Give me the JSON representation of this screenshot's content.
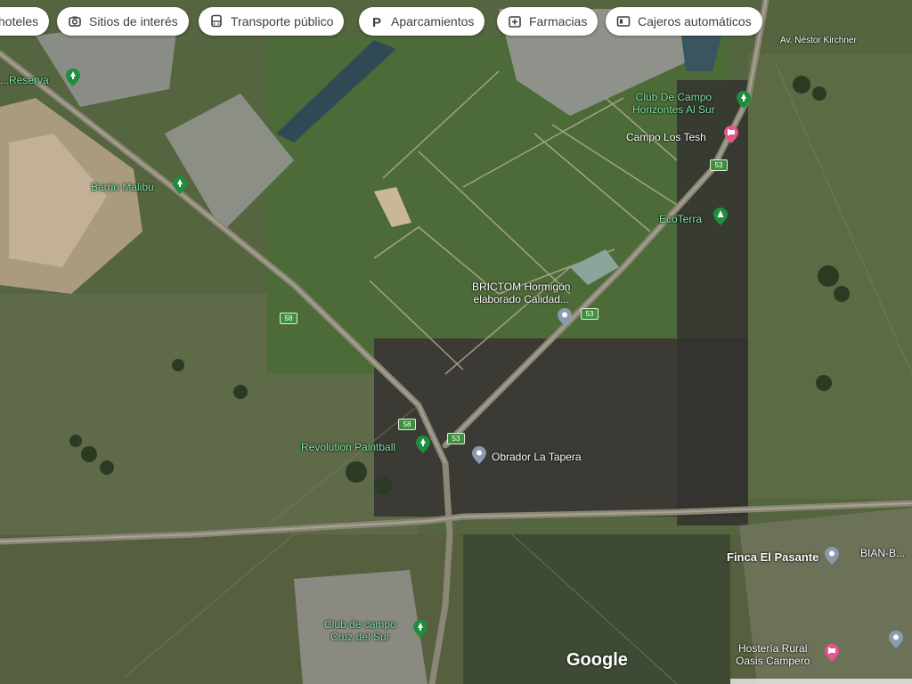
{
  "filters": [
    {
      "label": "hoteles",
      "icon": "hotel-icon"
    },
    {
      "label": "Sitios de interés",
      "icon": "camera-icon"
    },
    {
      "label": "Transporte público",
      "icon": "bus-icon"
    },
    {
      "label": "Aparcamientos",
      "icon": "parking-icon"
    },
    {
      "label": "Farmacias",
      "icon": "pharmacy-icon"
    },
    {
      "label": "Cajeros automáticos",
      "icon": "atm-icon"
    }
  ],
  "places": {
    "nestor_kirchner": "Av. Néstor Kirchner",
    "reserva": "...Reserva",
    "barrio_malibu": "Barrio Malibu",
    "club_horizontes_1": "Club De Campo",
    "club_horizontes_2": "Horizontes Al Sur",
    "campo_los_tesh": "Campo Los Tesh",
    "ecoterra": "EcoTerra",
    "brictom_1": "BRICTOM Hormigón",
    "brictom_2": "elaborado Calidad...",
    "revolution_paintball": "Revolution Paintball",
    "obrador_la_tapera": "Obrador La Tapera",
    "finca_el_pasante": "Finca El Pasante",
    "bian_b": "BIAN-B...",
    "club_cruz_1": "Club de campo",
    "club_cruz_2": "Cruz del Sur",
    "hosteria_1": "Hostería Rural",
    "hosteria_2": "Oasis Campero"
  },
  "route_shields": [
    "53",
    "58",
    "53",
    "58",
    "53"
  ],
  "attribution": "Google",
  "colors": {
    "park_green": "#1e8e3e",
    "park_label": "#7fe6a6",
    "hotel_pink": "#e8548c",
    "poi_gray": "#8a9bb0",
    "route_green": "#3f8f3f",
    "chip_bg": "#ffffff"
  }
}
